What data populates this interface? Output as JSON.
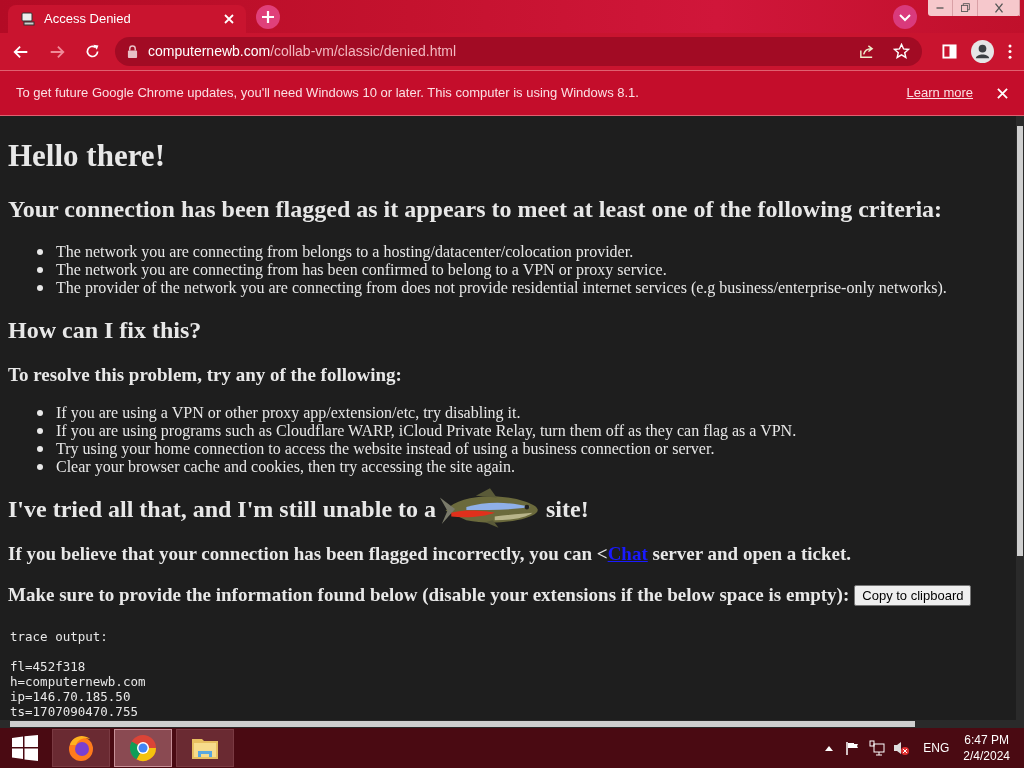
{
  "tab": {
    "title": "Access Denied"
  },
  "address_bar": {
    "domain": "computernewb.com",
    "path": "/collab-vm/classic/denied.html"
  },
  "infobar": {
    "message": "To get future Google Chrome updates, you'll need Windows 10 or later. This computer is using Windows 8.1.",
    "link": "Learn more"
  },
  "page": {
    "title": "Hello there!",
    "criteria_heading": "Your connection has been flagged as it appears to meet at least one of the following criteria:",
    "criteria": [
      "The network you are connecting from belongs to a hosting/datacenter/colocation provider.",
      "The network you are connecting from has been confirmed to belong to a VPN or proxy service.",
      "The provider of the network you are connecting from does not provide residential internet services (e.g business/enterprise-only networks)."
    ],
    "fix_heading": "How can I fix this?",
    "resolve_heading": "To resolve this problem, try any of the following:",
    "resolve_steps": [
      "If you are using a VPN or other proxy app/extension/etc, try disabling it.",
      "If you are using programs such as Cloudflare WARP, iCloud Private Relay, turn them off as they can flag as a VPN.",
      "Try using your home connection to access the website instead of using a business connection or server.",
      "Clear your browser cache and cookies, then try accessing the site again."
    ],
    "still_heading": {
      "before": "I've tried all that, and I'm still unable to a",
      "after": "site!"
    },
    "incorrect": {
      "before": "If you believe that your connection has been flagged incorrectly, you can <",
      "link": "Chat",
      "after": " server and open a ticket."
    },
    "info_text": "Make sure to provide the information found below (disable your extensions if the below space is empty):",
    "copy_button": "Copy to clipboard",
    "trace": {
      "label": "trace output:",
      "lines": [
        "fl=452f318",
        "h=computernewb.com",
        "ip=146.70.185.50",
        "ts=1707090470.755"
      ]
    }
  },
  "taskbar": {
    "apps": [
      {
        "kind": "firefox",
        "selected": false
      },
      {
        "kind": "chrome",
        "selected": true
      },
      {
        "kind": "folder",
        "selected": false
      }
    ],
    "language": "ENG",
    "time": "6:47 PM",
    "date": "2/4/2024"
  }
}
